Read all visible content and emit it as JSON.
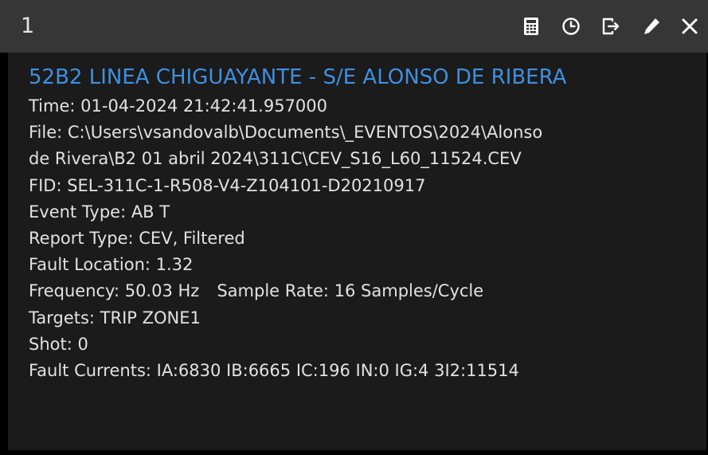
{
  "window": {
    "title": "1",
    "colors": {
      "titlebar": "#363636",
      "content_bg": "#1b1b1b",
      "heading": "#3f8fe0",
      "text": "#e2e2e2"
    },
    "toolbar": {
      "icons": [
        "calculator-icon",
        "clock-icon",
        "export-icon",
        "pencil-icon",
        "close-icon"
      ]
    }
  },
  "event": {
    "heading": "52B2 LINEA CHIGUAYANTE - S/E ALONSO DE RIBERA",
    "time": "Time:  01-04-2024 21:42:41.957000",
    "file_line1": "File: C:\\Users\\vsandovalb\\Documents\\_EVENTOS\\2024\\Alonso",
    "file_line2": "de Rivera\\B2 01 abril 2024\\311C\\CEV_S16_L60_11524.CEV",
    "fid": "FID: SEL-311C-1-R508-V4-Z104101-D20210917",
    "event_type": "Event Type: AB T",
    "report_type": "Report Type: CEV, Filtered",
    "fault_location": "Fault Location: 1.32",
    "frequency": "Frequency: 50.03 Hz",
    "sample_rate": "Sample Rate: 16 Samples/Cycle",
    "targets": "Targets: TRIP ZONE1",
    "shot": "Shot: 0",
    "fault_currents": "Fault Currents: IA:6830 IB:6665 IC:196 IN:0 IG:4 3I2:11514"
  }
}
